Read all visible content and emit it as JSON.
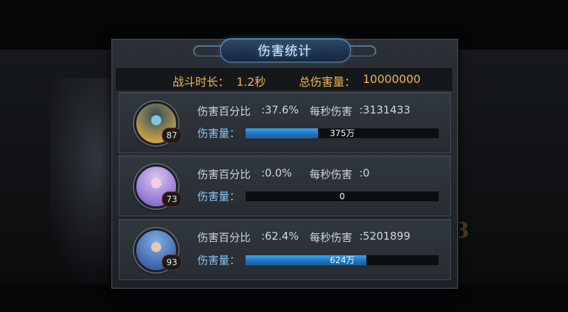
{
  "window": {
    "title": "伤害统计"
  },
  "summary": {
    "duration_label": "战斗时长：",
    "duration_value": "1.2秒",
    "total_label": "总伤害量：",
    "total_value": "10000000"
  },
  "labels": {
    "percent": "伤害百分比",
    "dps": "每秒伤害",
    "damage": "伤害量："
  },
  "heroes": [
    {
      "level": "87",
      "percent": ":37.6%",
      "dps": ":3131433",
      "damage_text": "375万",
      "damage_fraction": 0.375,
      "avatar_colors": [
        "#2c4a63",
        "#c9a446"
      ],
      "accent": "#7ec7d6"
    },
    {
      "level": "73",
      "percent": ":0.0%",
      "dps": ":0",
      "damage_text": "0",
      "damage_fraction": 0,
      "avatar_colors": [
        "#d9c8ef",
        "#8d6fd1"
      ],
      "accent": "#f3d0dd"
    },
    {
      "level": "93",
      "percent": ":62.4%",
      "dps": ":5201899",
      "damage_text": "624万",
      "damage_fraction": 0.624,
      "avatar_colors": [
        "#7fb0e6",
        "#3d5fa8"
      ],
      "accent": "#e8c9a8"
    }
  ],
  "background": {
    "partial_number": "3"
  }
}
